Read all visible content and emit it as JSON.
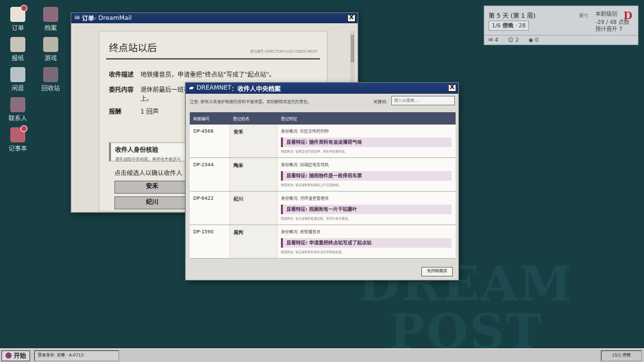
{
  "desktop": {
    "icons": [
      {
        "label": "订单",
        "icon": "mail-icon",
        "badge": true
      },
      {
        "label": "档案",
        "icon": "archive-icon",
        "badge": false
      },
      {
        "label": "报纸",
        "icon": "newspaper-icon",
        "badge": false
      },
      {
        "label": "游戏",
        "icon": "game-icon",
        "badge": false
      },
      {
        "label": "闲逛",
        "icon": "walk-icon",
        "badge": false
      },
      {
        "label": "回收站",
        "icon": "trash-icon",
        "badge": false
      },
      {
        "label": "联系人",
        "icon": "contacts-icon",
        "badge": false
      },
      {
        "label": "记事本",
        "icon": "notebook-icon",
        "badge": true
      }
    ],
    "watermark": {
      "big": "DREAM POST",
      "small": "PROGRAM CENTER·TERMINAL"
    }
  },
  "status": {
    "day": "第 5 天 (第 1 周)",
    "week_prefix": "1/6",
    "week_label": "傍晚",
    "week_suffix": "· 28",
    "tag": "第七",
    "rank": "本职级别",
    "points": "-29 / 48 点数",
    "target": "预计晋升 7",
    "logo": "D",
    "counts": [
      "4",
      "2",
      "0"
    ]
  },
  "mail": {
    "title_app": "订单",
    "title_sep": " - DreamMail",
    "close": "X",
    "heading": "终点站以后",
    "serial": "委托编号 DIRECTORY-LOST-ONEDCMENT",
    "rows": [
      {
        "label": "收件描述",
        "value": "地铁播音员，申请重把\"终点站\"写成了\"起点站\"。"
      },
      {
        "label": "委托内容",
        "value": "退休前最后一班车，"
      },
      {
        "label": "",
        "value": "上。"
      },
      {
        "label": "报酬",
        "value": "1 回声"
      }
    ],
    "verify_title": "收件人身份核验",
    "verify_sub": "遵先调取中央档案，再将收件据送与",
    "pick_label": "点击候选人以确认收件人",
    "candidates": [
      "安禾",
      "纪川"
    ]
  },
  "net": {
    "title_app": "DREAMNET",
    "title_sep": "：",
    "title_page": "收件人中央档案",
    "close": "X",
    "note": "注意: 即有义务保护档案的资料不被泄露，否则解释须追究的责任。",
    "keyword_label": "关键词:",
    "search_placeholder": "键入以搜索...",
    "columns": [
      "档案编号",
      "登记姓名",
      "登记特征"
    ],
    "rows": [
      {
        "id": "DP-4566",
        "name": "安禾",
        "overview": "身份概况: 社区诊所药剂师",
        "mark": "显著特征: 随件资料有淡淡薄荷气味",
        "remark": "档案附注: 该来自出行前出神，待夫手段来的说。"
      },
      {
        "id": "DP-2344",
        "name": "陶米",
        "overview": "身份概况: 旧城区电车司机",
        "mark": "显著特征: 随档物件是一枚停用车票",
        "remark": "档案附注: 该记录附有标题的上行与回收程。"
      },
      {
        "id": "DP-6422",
        "name": "纪川",
        "overview": "身份概况: 河岸温室管理员",
        "mark": "显著特征: 档案附有一片干枯藤叶",
        "remark": "档案附注: 该头出版的挂满注意，还有片段大来说。"
      },
      {
        "id": "DP-1590",
        "name": "周判",
        "overview": "身份概况: 地铁播音员",
        "mark": "显著特征: 申请重把终点站写成了起点站",
        "remark": "档案附注: 该记录附有标有标记的手和核验是。"
      }
    ],
    "close_button": "关闭档案库"
  },
  "taskbar": {
    "start": "开始",
    "login": "登录身份: 安睡 · A-0713",
    "tray": "15/1 傍晚"
  }
}
